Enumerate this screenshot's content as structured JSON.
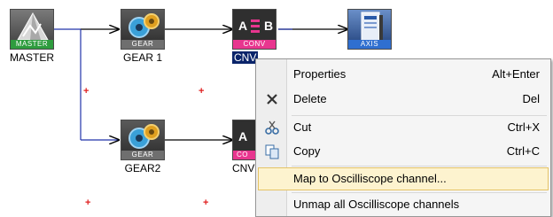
{
  "diagram": {
    "nodes": {
      "master": {
        "caption": "MASTER",
        "strip": "MASTER",
        "icon": "master-triangle-icon"
      },
      "gear1": {
        "caption": "GEAR 1",
        "strip": "GEAR",
        "icon": "gear-icon"
      },
      "conv1": {
        "caption": "CNV",
        "strip": "CONV",
        "tile_left": "A",
        "tile_right": "B",
        "icon": "converter-icon"
      },
      "axis1": {
        "caption": "",
        "strip": "AXIS",
        "icon": "axis-drive-icon"
      },
      "gear2": {
        "caption": "GEAR2",
        "strip": "GEAR",
        "icon": "gear-icon"
      },
      "conv2": {
        "caption": "CNV",
        "strip": "CO",
        "tile_left": "A",
        "icon": "converter-icon"
      }
    },
    "plus_glyph": "+"
  },
  "context_menu": {
    "items": [
      {
        "label": "Properties",
        "shortcut": "Alt+Enter",
        "icon": ""
      },
      {
        "label": "Delete",
        "shortcut": "Del",
        "icon": "delete-x-icon"
      },
      {
        "label": "Cut",
        "shortcut": "Ctrl+X",
        "icon": "scissors-icon"
      },
      {
        "label": "Copy",
        "shortcut": "Ctrl+C",
        "icon": "copy-icon"
      },
      {
        "label": "Map to Oscilliscope channel...",
        "shortcut": "",
        "icon": "",
        "highlighted": true
      },
      {
        "label": "Unmap all Oscilliscope channels",
        "shortcut": "",
        "icon": ""
      }
    ]
  },
  "colors": {
    "connector": "#2233aa",
    "arrow": "#000000",
    "plus": "#e02020",
    "selection": "#0a246a",
    "menu_highlight": "#fdf3cf",
    "converter_accent": "#e8368f"
  }
}
